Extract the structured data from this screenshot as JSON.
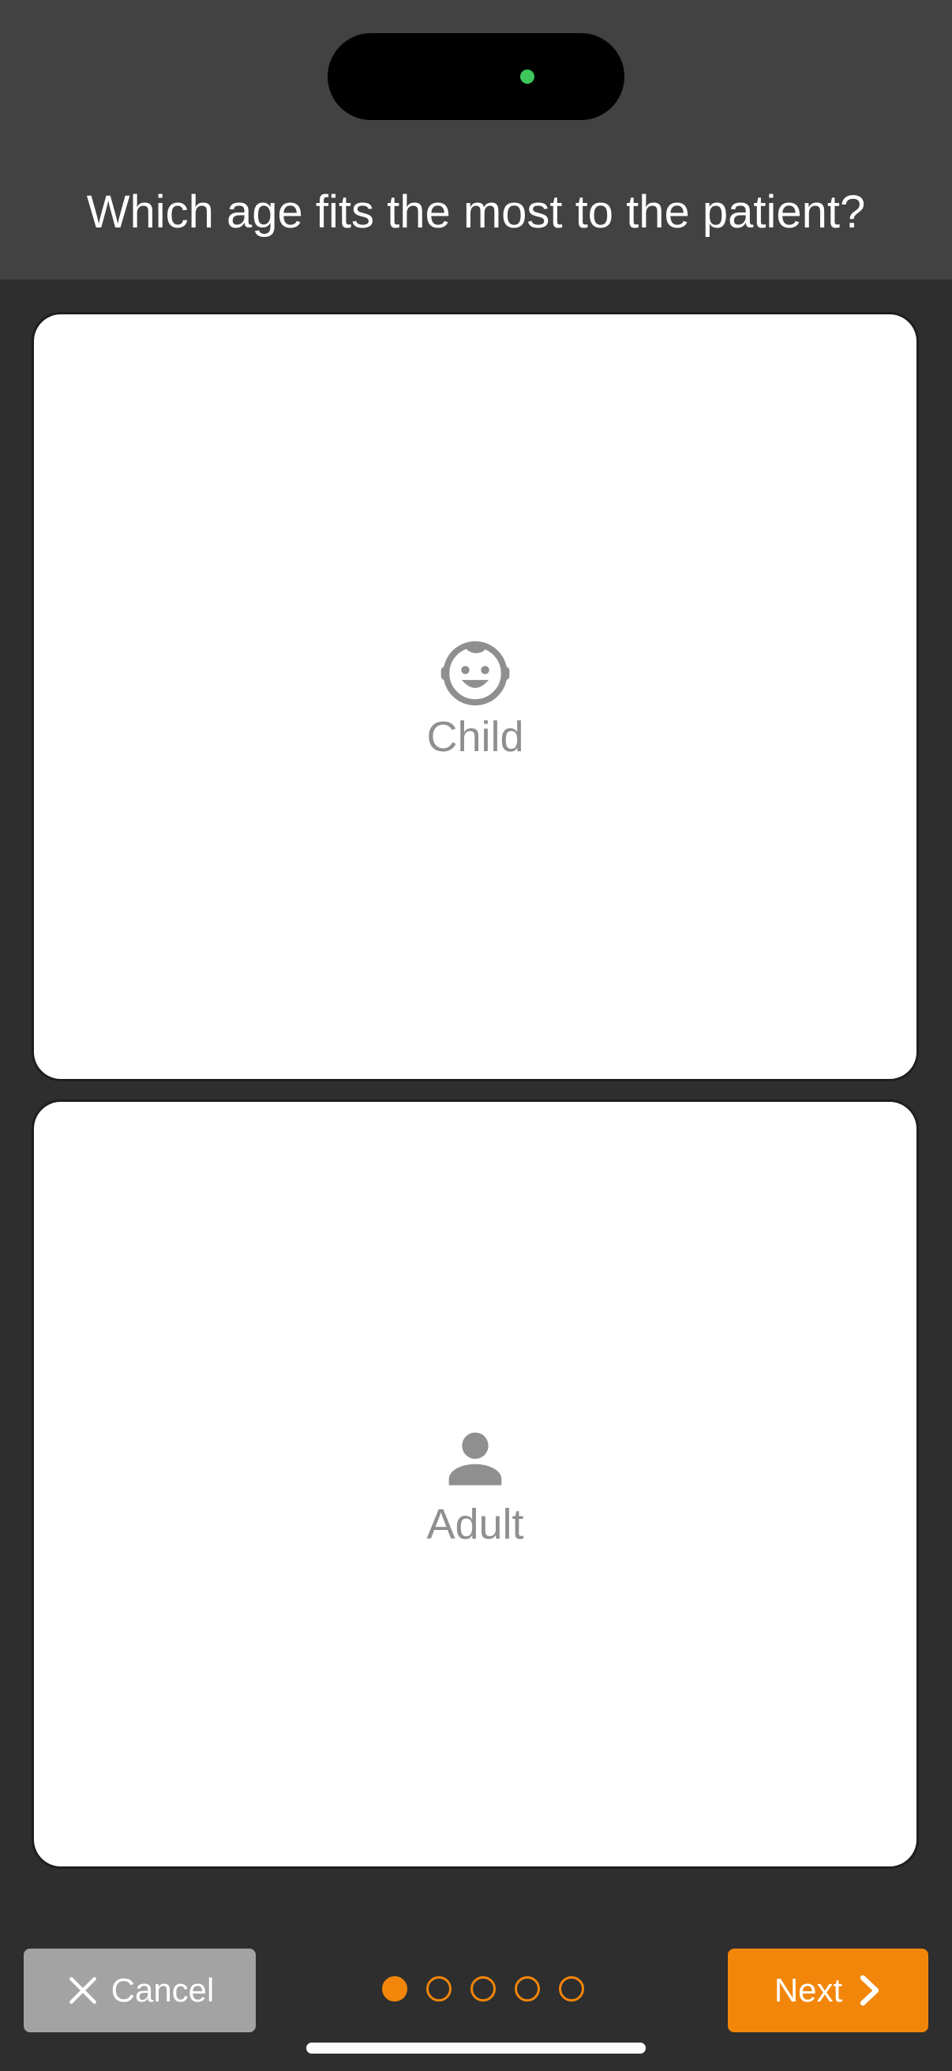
{
  "header": {
    "question": "Which age fits the most to the patient?"
  },
  "options": [
    {
      "label": "Child",
      "icon": "child-face-icon"
    },
    {
      "label": "Adult",
      "icon": "person-icon"
    }
  ],
  "footer": {
    "cancel_label": "Cancel",
    "next_label": "Next",
    "progress": {
      "current_step": 1,
      "total_steps": 5
    }
  },
  "colors": {
    "accent": "#f2860a",
    "background": "#2e2e2e",
    "header": "#424242",
    "cancel": "#a3a3a3",
    "icon": "#8f8f8f"
  }
}
